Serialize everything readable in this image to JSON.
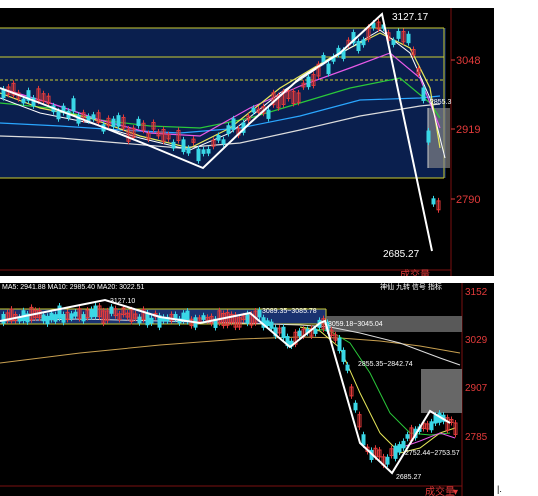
{
  "top_chart": {
    "axis_labels": [
      "3048",
      "2919",
      "2790"
    ],
    "high_label": "3127.17",
    "low_label": "2685.27",
    "partial_label": "2855.3",
    "footer_tab": "成交量",
    "colors": {
      "background": "#000000",
      "band": "#0a1f4e",
      "up": "#e23a3a",
      "down": "#3ad7e6",
      "axis": "#e23a3a",
      "box": "#cccc33",
      "zigzag": "#ffffff"
    }
  },
  "bottom_chart": {
    "header_left": "MA5: 2941.88 MA10: 2985.40 MA20: 3022.51",
    "header_right": "神仙 九转 信号 指标",
    "axis_labels": [
      "3152",
      "3029",
      "2907",
      "2785"
    ],
    "high_label": "3127.10",
    "low_label": "2685.27",
    "annotations": [
      "3089.35~3085.78",
      "3059.18~3045.04",
      "2855.35~2842.74",
      "2752.44~2753.57"
    ],
    "footer_tab": "成交量",
    "colors": {
      "background": "#000000",
      "band": "#1a3270",
      "up": "#e23a3a",
      "down": "#3ad7e6",
      "axis": "#e23a3a",
      "box": "#cccc33",
      "zigzag": "#ffffff"
    }
  },
  "stray_mark": "|."
}
